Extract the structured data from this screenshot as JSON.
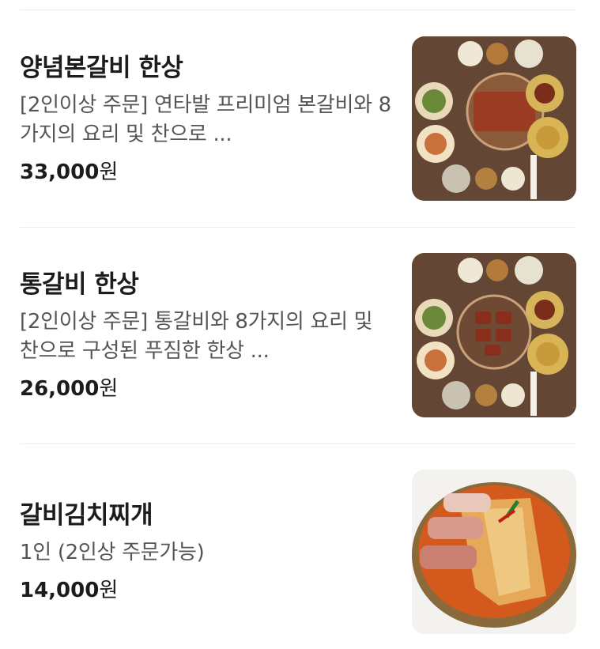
{
  "menu": [
    {
      "title": "양념본갈비 한상",
      "description": "[2인이상 주문] 연타발 프리미엄 본갈비와 8가지의 요리 및 찬으로 ...",
      "price": "33,000",
      "currency": "원",
      "image": "food-photo"
    },
    {
      "title": "통갈비 한상",
      "description": "[2인이상 주문] 통갈비와 8가지의 요리 및 찬으로 구성된 푸짐한 한상 ...",
      "price": "26,000",
      "currency": "원",
      "image": "food-photo"
    },
    {
      "title": "갈비김치찌개",
      "description": "1인 (2인상 주문가능)",
      "price": "14,000",
      "currency": "원",
      "image": "food-photo"
    }
  ]
}
